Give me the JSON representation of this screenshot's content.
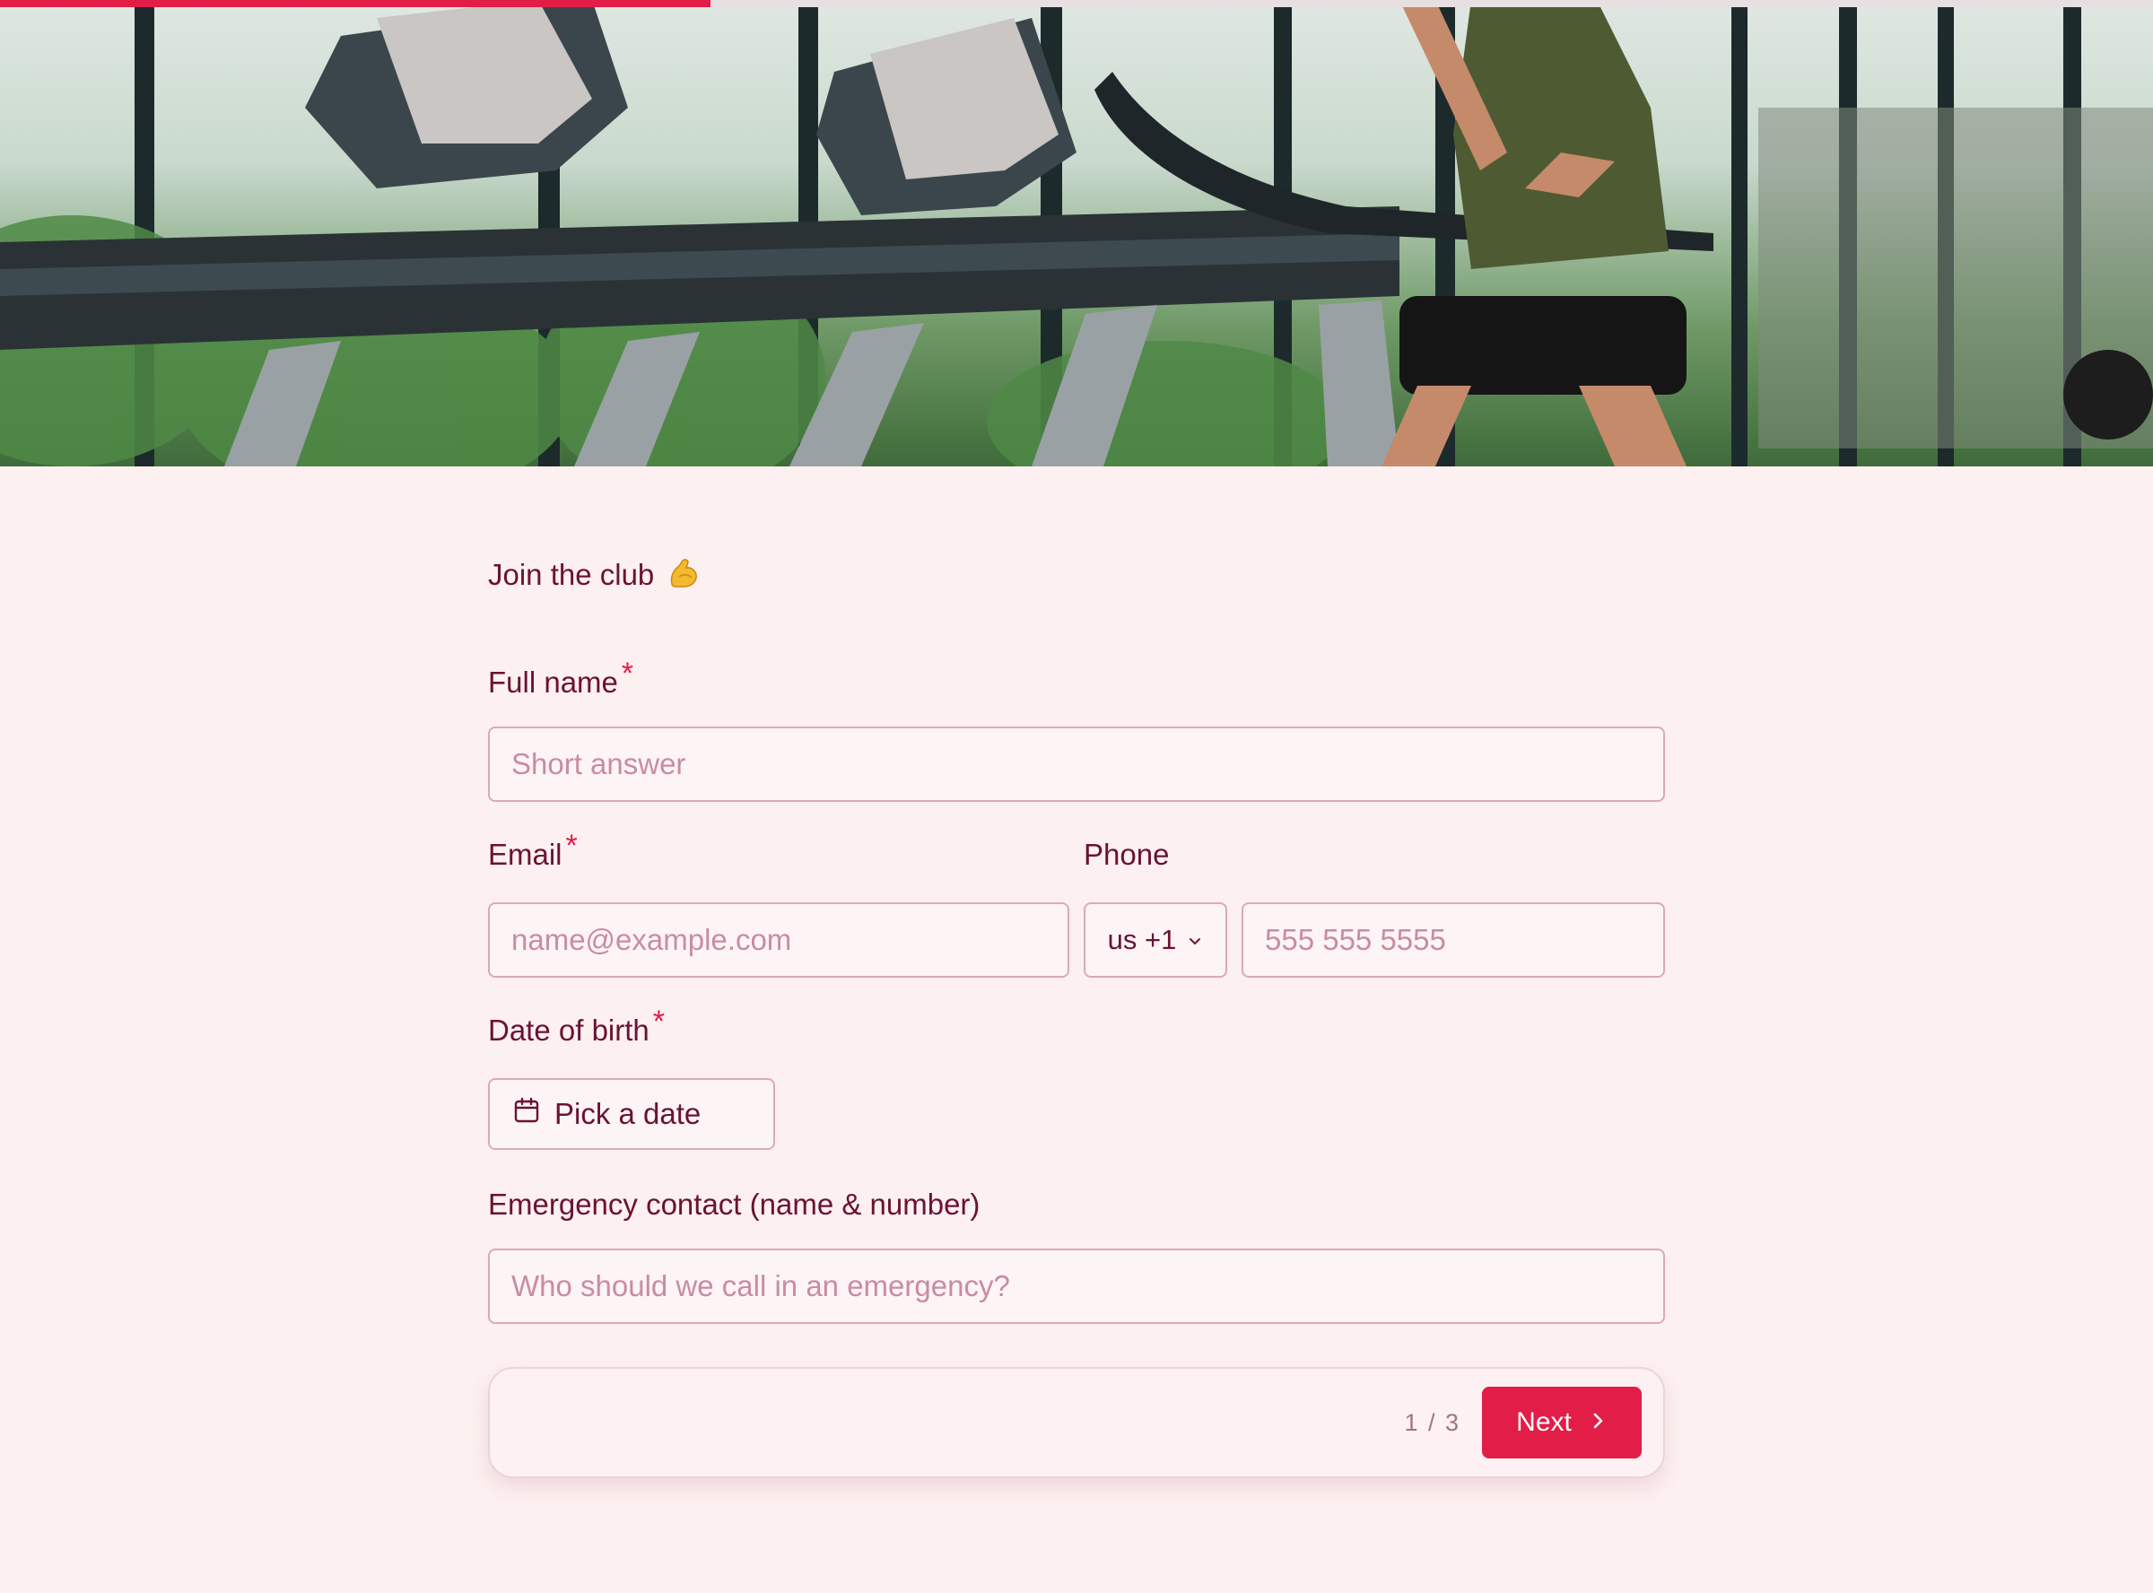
{
  "progress": {
    "fraction": 0.33
  },
  "hero": {
    "image_alt_subject": "treadmills-in-gym"
  },
  "form": {
    "title": "Join the club",
    "title_icon": "flexed-biceps-icon",
    "full_name": {
      "label": "Full name",
      "required_mark": "*",
      "placeholder": "Short answer"
    },
    "email": {
      "label": "Email",
      "required_mark": "*",
      "placeholder": "name@example.com"
    },
    "phone": {
      "label": "Phone",
      "country_code": "us +1",
      "placeholder": "555 555 5555"
    },
    "dob": {
      "label": "Date of birth",
      "required_mark": "*",
      "button_label": "Pick a date"
    },
    "emergency": {
      "label": "Emergency contact (name & number)",
      "placeholder": "Who should we call in an emergency?"
    }
  },
  "footer": {
    "page_indicator": "1 / 3",
    "next_label": "Next"
  },
  "colors": {
    "accent": "#e11d48",
    "text": "#6b1233",
    "background": "#fdf0f0"
  }
}
